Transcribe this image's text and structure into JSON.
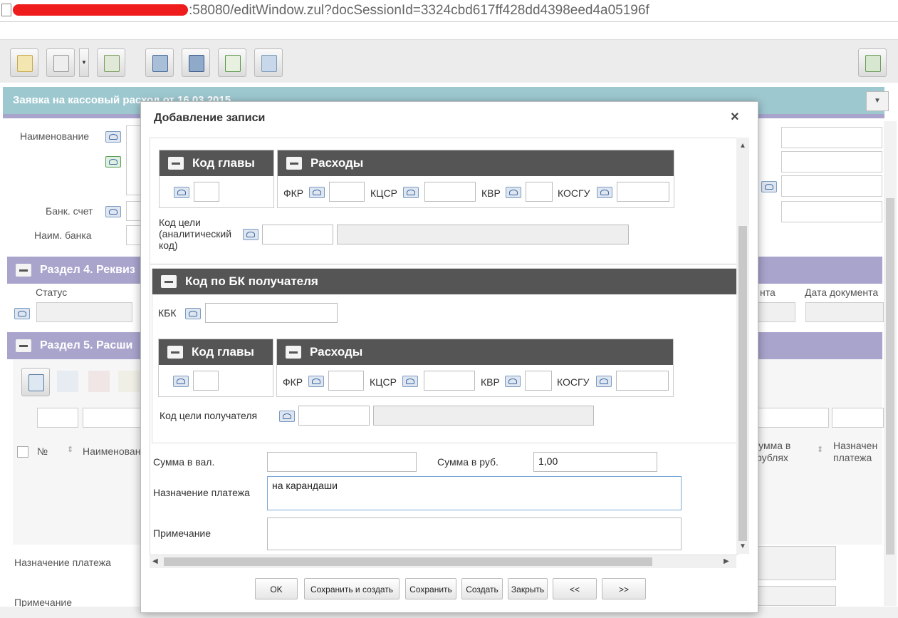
{
  "url": {
    "visible_text": ":58080/editWindow.zul?docSessionId=3324cbd617ff428dd4398eed4a05196f"
  },
  "background": {
    "header_title": "Заявка на кассовый расход от 16.03.2015",
    "fields": {
      "name_label": "Наименование",
      "bank_account_label": "Банк. счет",
      "bank_name_label": "Наим. банка",
      "payment_purpose_label": "Назначение платежа",
      "note_label": "Примечание"
    },
    "section4": {
      "title": "Раздел 4. Реквиз",
      "status_label": "Статус",
      "doc_num_partial": "нта",
      "doc_date_label": "Дата документа"
    },
    "section5": {
      "title": "Раздел 5. Расши",
      "col_num": "№",
      "col_name": "Наименован",
      "col_sum_partial_1": "Сумма в",
      "col_sum_partial_2": "рублях",
      "col_purpose_1": "Назначен",
      "col_purpose_2": "платежа"
    }
  },
  "modal": {
    "title": "Добавление записи",
    "group1": {
      "kod_glavy": "Код главы",
      "rashody": "Расходы",
      "fkr": "ФКР",
      "kcsr": "КЦСР",
      "kvr": "КВР",
      "kosgu": "КОСГУ",
      "kod_celi_label_1": "Код цели",
      "kod_celi_label_2": "(аналитический",
      "kod_celi_label_3": "код)"
    },
    "group2": {
      "title": "Код по БК получателя",
      "kbk": "КБК",
      "kod_glavy": "Код главы",
      "rashody": "Расходы",
      "fkr": "ФКР",
      "kcsr": "КЦСР",
      "kvr": "КВР",
      "kosgu": "КОСГУ",
      "kod_celi_poluch": "Код цели получателя"
    },
    "sum_val_label": "Сумма в вал.",
    "sum_rub_label": "Сумма в руб.",
    "sum_rub_value": "1,00",
    "purpose_label": "Назначение платежа",
    "purpose_value": "на карандаши",
    "note_label": "Примечание",
    "buttons": {
      "ok": "OK",
      "save_create": "Сохранить и создать",
      "save": "Сохранить",
      "create": "Создать",
      "close": "Закрыть",
      "prev": "<<",
      "next": ">>"
    }
  },
  "colors": {
    "header_teal": "#9ec8d0",
    "section_purple": "#a8a4cc",
    "group_head": "#555555"
  }
}
